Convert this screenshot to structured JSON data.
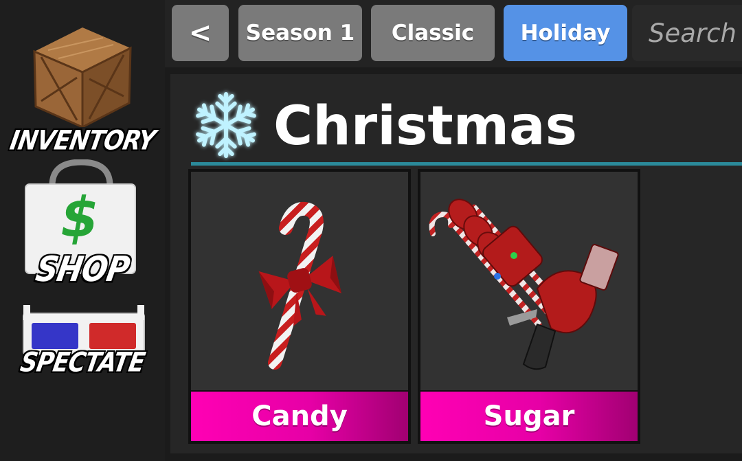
{
  "sidebar": {
    "items": [
      {
        "label": "INVENTORY",
        "icon": "crate-icon"
      },
      {
        "label": "SHOP",
        "icon": "shopping-bag-icon"
      },
      {
        "label": "SPECTATE",
        "icon": "3d-glasses-icon"
      }
    ]
  },
  "topbar": {
    "back_label": "<",
    "tabs": [
      {
        "label": "Season 1",
        "active": false
      },
      {
        "label": "Classic",
        "active": false
      },
      {
        "label": "Holiday",
        "active": true
      }
    ],
    "search_placeholder": "Search"
  },
  "section": {
    "title": "Christmas",
    "icon": "snowflake-icon",
    "accent": "#2b8a9a"
  },
  "items": [
    {
      "name": "Candy",
      "icon": "candy-cane-icon"
    },
    {
      "name": "Sugar",
      "icon": "candy-cane-gun-icon"
    }
  ],
  "colors": {
    "active_tab": "#5592e6",
    "inactive_tab": "#7a7a7a",
    "item_label": "#ff00b4"
  }
}
